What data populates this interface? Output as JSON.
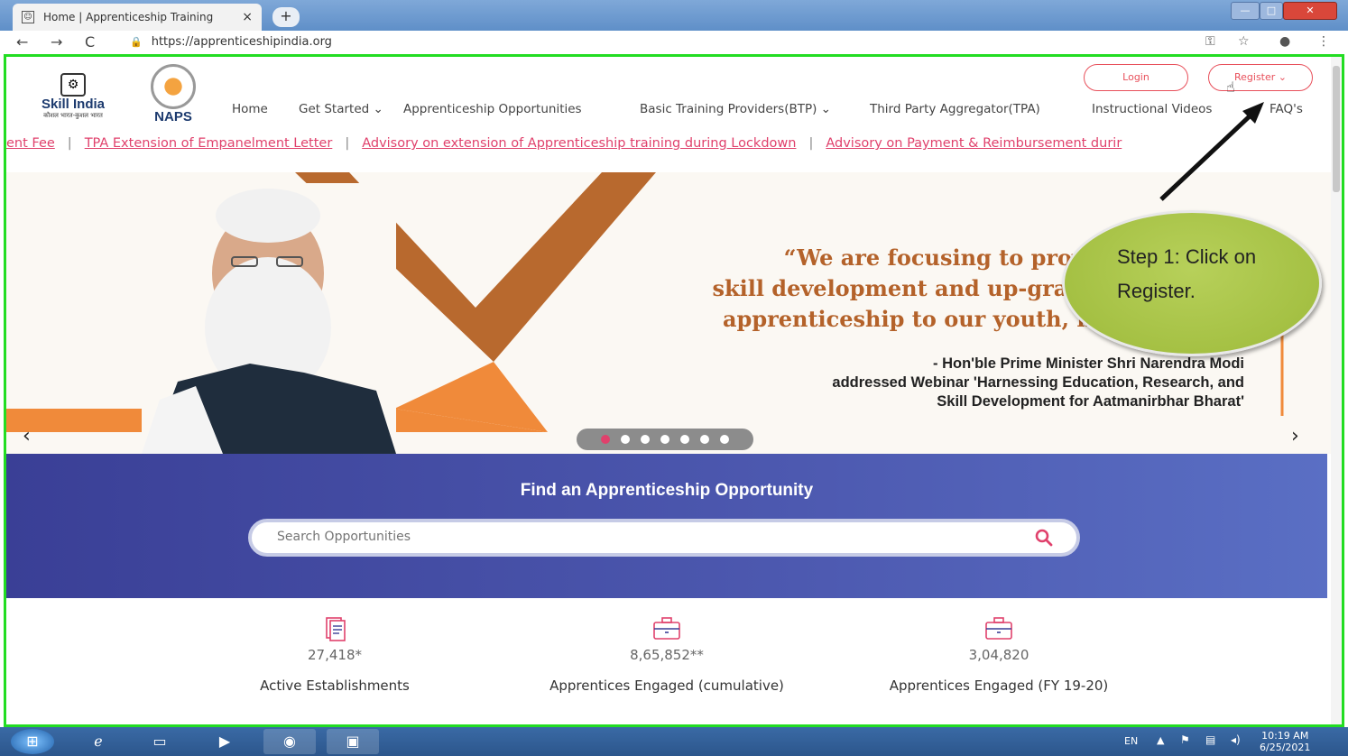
{
  "browser": {
    "tab_title": "Home | Apprenticeship Training",
    "tab_close": "×",
    "new_tab": "+",
    "url": "https://apprenticeshipindia.org",
    "win_min": "—",
    "win_max": "□",
    "win_close": "✕",
    "nav_back": "←",
    "nav_forward": "→",
    "nav_reload": "C"
  },
  "header": {
    "skill_india": "Skill India",
    "skill_india_sub": "कौशल भारत-कुशल भारत",
    "naps": "NAPS",
    "login": "Login",
    "register": "Register ⌄",
    "nav": {
      "home": "Home",
      "get_started": "Get Started ⌄",
      "opportunities": "Apprenticeship Opportunities",
      "btp": "Basic Training Providers(BTP) ⌄",
      "tpa": "Third Party Aggregator(TPA)",
      "videos": "Instructional Videos",
      "faqs": "FAQ's"
    }
  },
  "ticker": {
    "items": [
      "ent Fee",
      "TPA Extension of Empanelment Letter",
      "Advisory on extension of Apprenticeship training during Lockdown",
      "Advisory on Payment & Reimbursement durir"
    ]
  },
  "banner": {
    "quote_line1": "“We are focusing to provide world-class",
    "quote_line2": "skill development and up-gradation, research",
    "quote_line3": "apprenticeship to our youth, in the country.”",
    "attrib_line1": "- Hon'ble Prime Minister Shri Narendra Modi",
    "attrib_line2": "addressed Webinar 'Harnessing Education, Research, and",
    "attrib_line3": "Skill Development for Aatmanirbhar Bharat'",
    "prev": "‹",
    "next": "›",
    "slide_count": 7,
    "active_slide": 1
  },
  "search": {
    "title": "Find an Apprenticeship Opportunity",
    "placeholder": "Search Opportunities"
  },
  "stats": [
    {
      "value": "27,418*",
      "label": "Active Establishments"
    },
    {
      "value": "8,65,852**",
      "label": "Apprentices Engaged (cumulative)"
    },
    {
      "value": "3,04,820",
      "label": "Apprentices Engaged (FY 19-20)"
    }
  ],
  "callout": {
    "line1": "Step 1: Click on",
    "line2": "Register."
  },
  "taskbar": {
    "lang": "EN",
    "time": "10:19 AM",
    "date": "6/25/2021"
  },
  "colors": {
    "accent_pink": "#e0416c",
    "banner_orange": "#f08a3a",
    "search_blue": "#3a3f96",
    "highlight_green": "#22dd22",
    "callout_green": "#9dba3a"
  }
}
